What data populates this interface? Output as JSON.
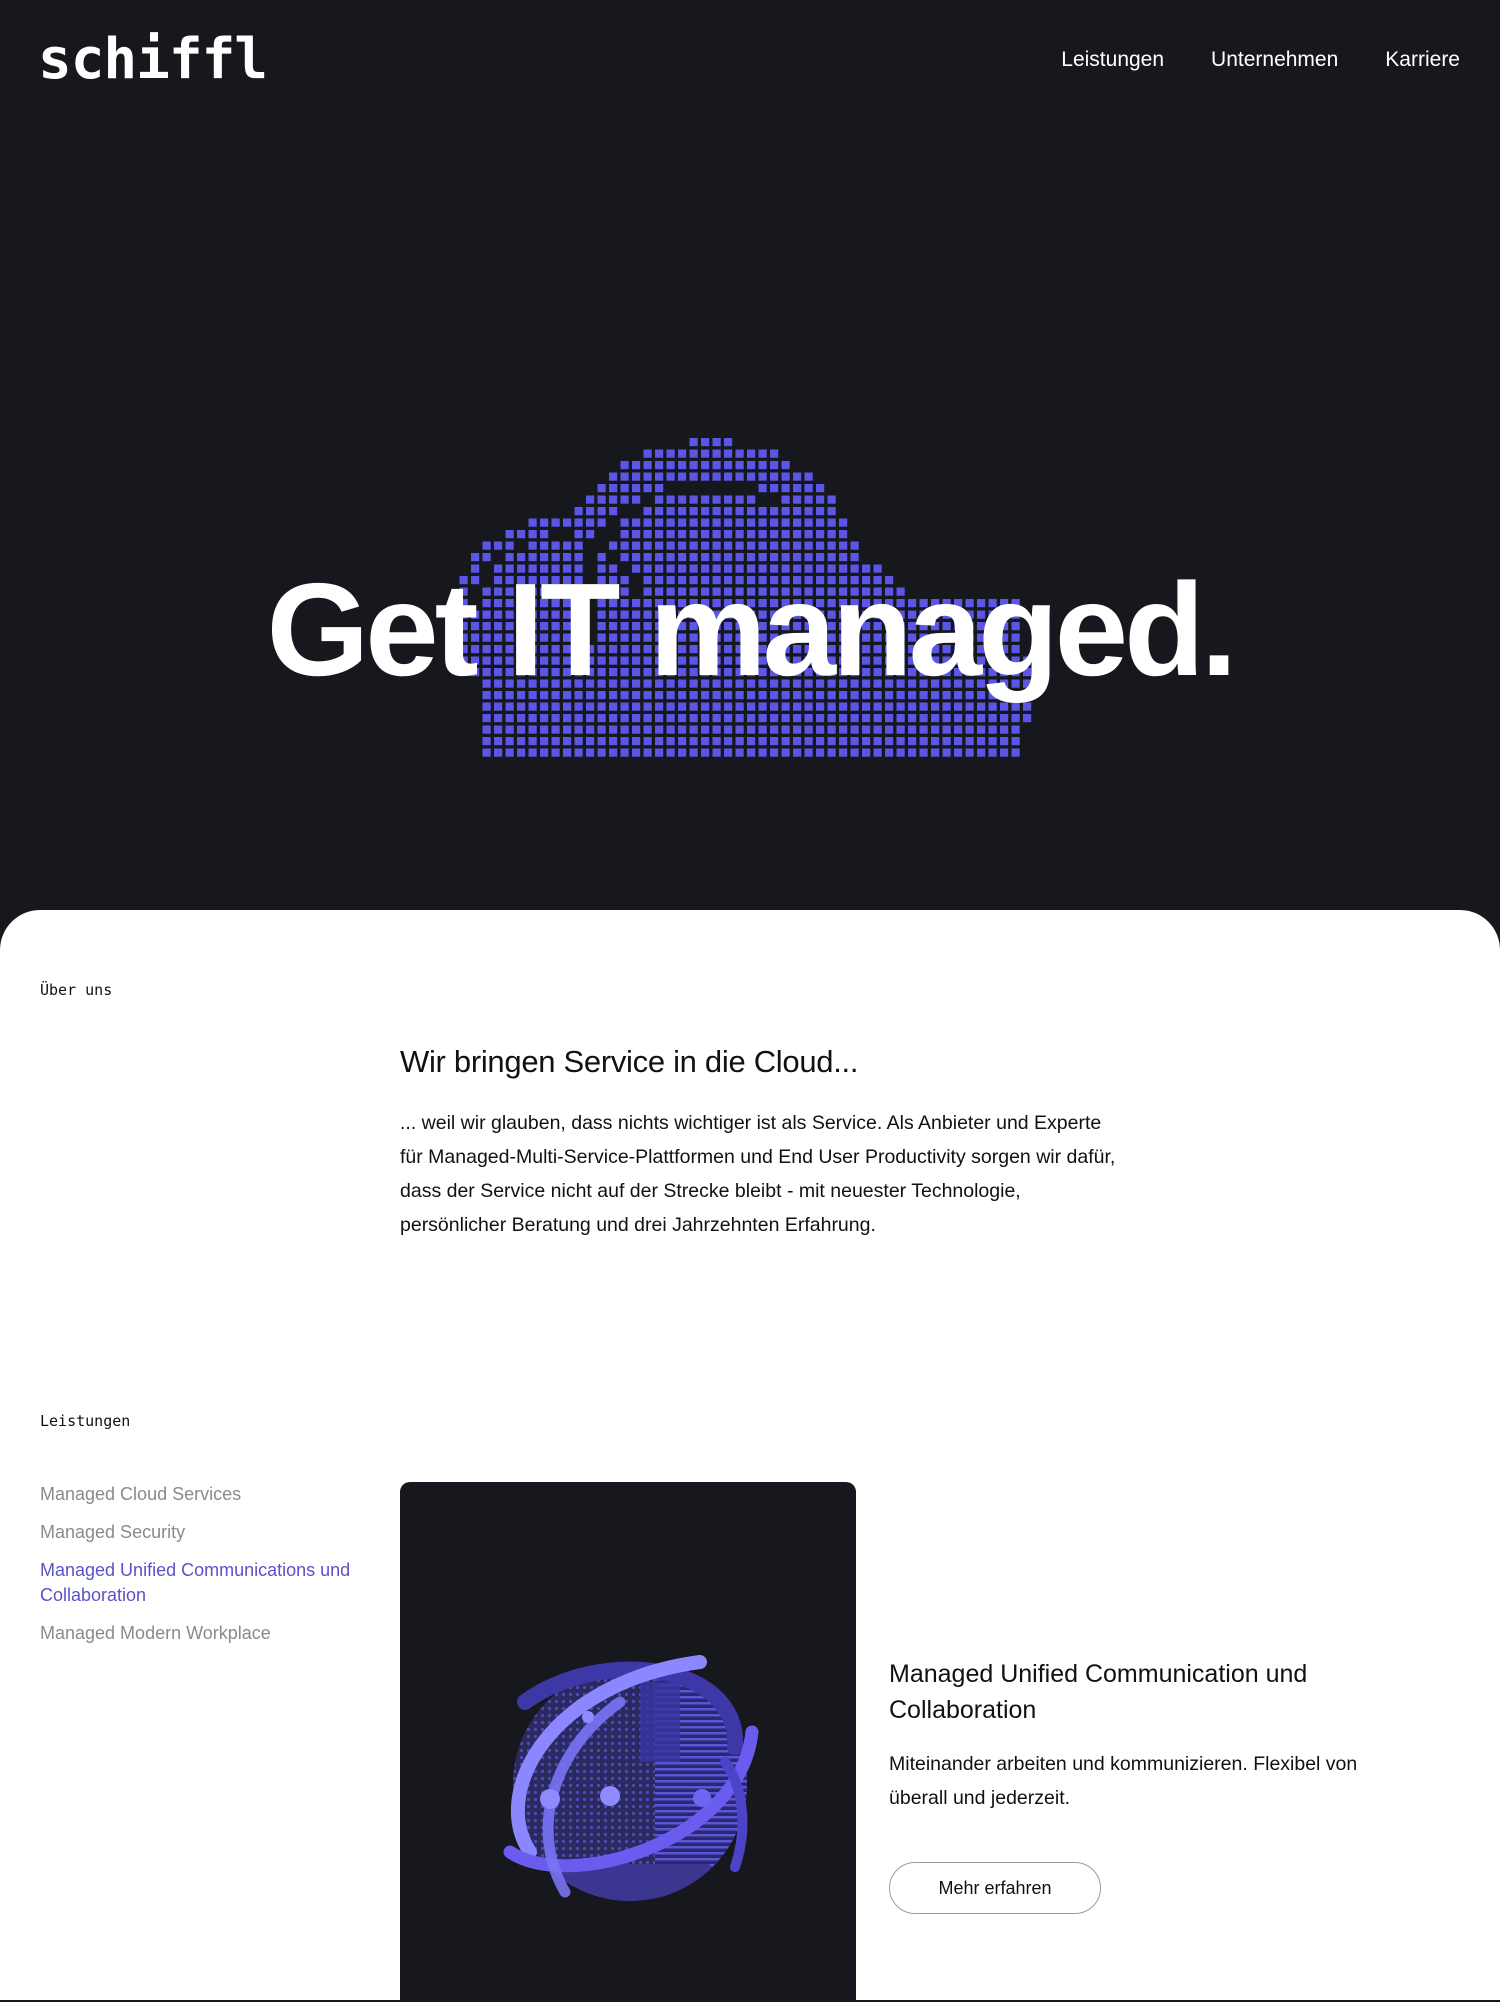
{
  "header": {
    "logo": "schiffl",
    "nav": [
      "Leistungen",
      "Unternehmen",
      "Karriere"
    ]
  },
  "hero": {
    "title": "Get IT managed.",
    "accent_color": "#5b56e8",
    "illustration": "pixel-cloud"
  },
  "about": {
    "eyebrow": "Über uns",
    "title": "Wir bringen Service in die Cloud...",
    "text": "... weil wir glauben, dass nichts wichtiger ist als Service. Als Anbieter und Experte für Managed-Multi-Service-Plattformen und End User Productivity sorgen wir dafür, dass der Service nicht auf der Strecke bleibt - mit neuester Technologie, persönlicher Beratung und drei Jahrzehnten Erfahrung."
  },
  "services": {
    "eyebrow": "Leistungen",
    "items": [
      {
        "label": "Managed Cloud Services",
        "active": false
      },
      {
        "label": "Managed Security",
        "active": false
      },
      {
        "label": "Managed Unified Communications und Collaboration",
        "active": true
      },
      {
        "label": "Managed Modern Workplace",
        "active": false
      }
    ],
    "active_color": "#5a52c8",
    "card": {
      "illustration": "globe-orbit",
      "title": "Managed Unified Communication und Collaboration",
      "description": "Miteinander arbeiten und kommunizieren. Flexibel von überall und jederzeit.",
      "button": "Mehr erfahren"
    }
  },
  "colors": {
    "background_dark": "#17181d",
    "panel": "#ffffff",
    "text": "#111111"
  }
}
